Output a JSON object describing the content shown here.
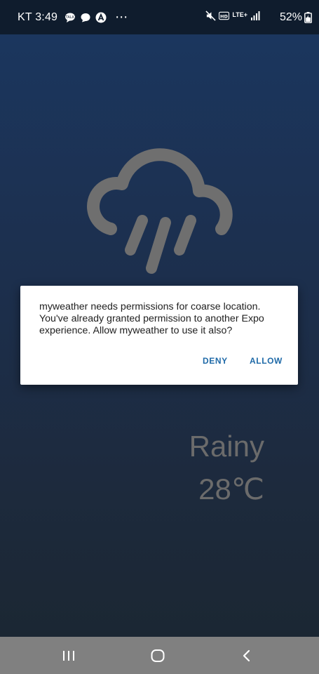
{
  "status_bar": {
    "time": "KT 3:49",
    "more": "⋯",
    "network": "LTE+",
    "battery": "52%",
    "icons": [
      "chat-bubble-icon",
      "message-icon",
      "arrow-a-icon",
      "mute-icon",
      "hd-icon",
      "lte-icon",
      "signal-icon",
      "battery-icon"
    ]
  },
  "weather": {
    "condition": "Rainy",
    "temperature": "28℃",
    "icon": "rain-cloud-icon"
  },
  "dialog": {
    "message": "myweather needs permissions for coarse location. You've already granted permission to another Expo experience. Allow myweather to use it also?",
    "deny_label": "DENY",
    "allow_label": "ALLOW",
    "button_color": "#1f6aa8"
  },
  "nav": {
    "icons": [
      "recent-apps-icon",
      "home-icon",
      "back-icon"
    ]
  },
  "colors": {
    "status_bar": "#0f1c2d",
    "bg_top": "#1b365e",
    "bg_bottom": "#1b2733",
    "weather_text": "#6b6b6b",
    "nav_bar": "#808080"
  }
}
